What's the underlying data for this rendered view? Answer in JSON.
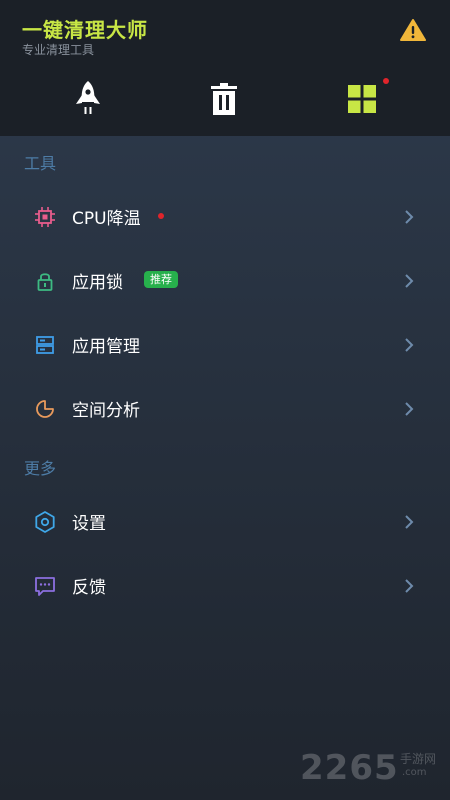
{
  "header": {
    "title": "一键清理大师",
    "subtitle": "专业清理工具",
    "warning_icon": "warning-icon",
    "accent_color": "#c8e645"
  },
  "toolbar": [
    {
      "icon": "rocket-icon"
    },
    {
      "icon": "trash-icon"
    },
    {
      "icon": "grid-icon",
      "has_dot": true
    }
  ],
  "sections": {
    "tools_title": "工具",
    "more_title": "更多"
  },
  "tools": [
    {
      "label": "CPU降温",
      "icon": "chip-icon",
      "has_dot": true
    },
    {
      "label": "应用锁",
      "icon": "lock-icon",
      "badge": "推荐"
    },
    {
      "label": "应用管理",
      "icon": "app-manage-icon"
    },
    {
      "label": "空间分析",
      "icon": "pie-chart-icon"
    }
  ],
  "more": [
    {
      "label": "设置",
      "icon": "gear-icon"
    },
    {
      "label": "反馈",
      "icon": "feedback-icon"
    }
  ],
  "watermark": {
    "main": "2265",
    "small": "手游网",
    "domain": ".com"
  },
  "colors": {
    "header_bg": "#1b2027",
    "section_title": "#4d7ca6",
    "badge_green": "#27b04c",
    "dot_red": "#e0242b"
  }
}
